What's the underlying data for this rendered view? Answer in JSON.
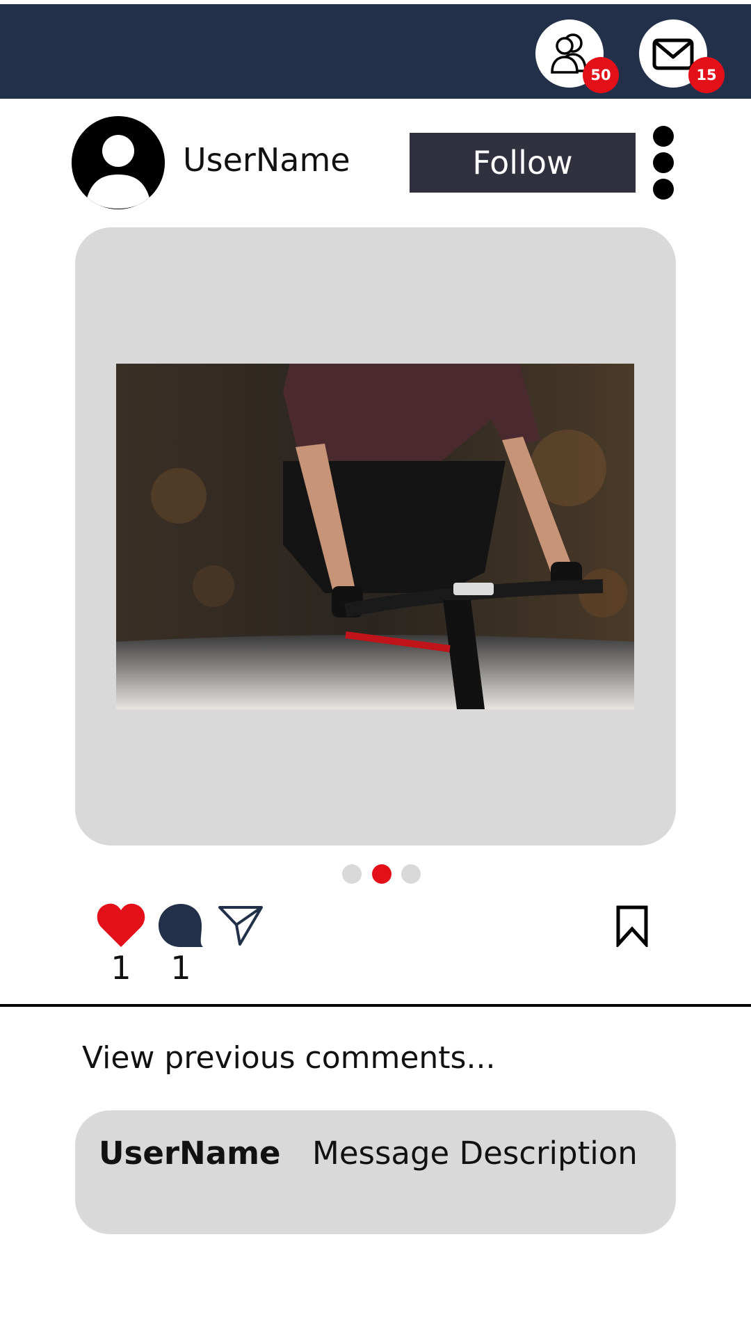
{
  "header": {
    "friends_badge": "50",
    "messages_badge": "15",
    "colors": {
      "bar": "#22304a",
      "badge": "#e3101a"
    },
    "icons": [
      "friends-icon",
      "mail-icon"
    ]
  },
  "post": {
    "username": "UserName",
    "follow_label": "Follow",
    "icons": [
      "avatar-icon",
      "more-vertical-icon"
    ],
    "carousel": {
      "count": 3,
      "active_index": 1
    }
  },
  "actions": {
    "likes": "1",
    "comments": "1",
    "icons": [
      "heart-icon",
      "comment-icon",
      "send-icon",
      "bookmark-icon"
    ],
    "colors": {
      "like": "#e3101a",
      "comment": "#22304a"
    }
  },
  "comments": {
    "view_previous": "View previous comments...",
    "items": [
      {
        "user": "UserName",
        "message": "Message Description"
      }
    ]
  }
}
